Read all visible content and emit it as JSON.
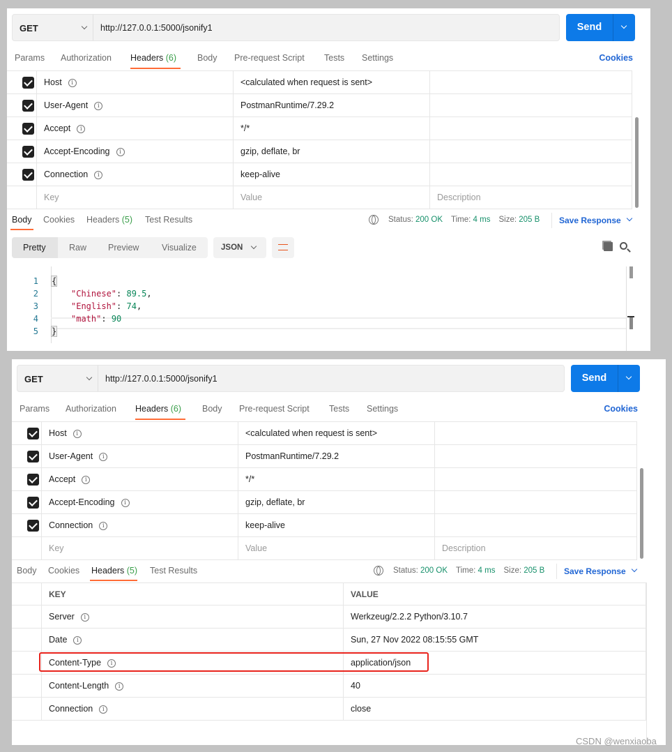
{
  "panels": [
    {
      "method": "GET",
      "url": "http://127.0.0.1:5000/jsonify1",
      "send_label": "Send",
      "request_tabs": [
        {
          "label": "Params"
        },
        {
          "label": "Authorization"
        },
        {
          "label": "Headers",
          "count": "(6)",
          "active": true
        },
        {
          "label": "Body"
        },
        {
          "label": "Pre-request Script"
        },
        {
          "label": "Tests"
        },
        {
          "label": "Settings"
        }
      ],
      "cookies_link": "Cookies",
      "request_headers": [
        {
          "key": "Host",
          "value": "<calculated when request is sent>",
          "checked": true
        },
        {
          "key": "User-Agent",
          "value": "PostmanRuntime/7.29.2",
          "checked": true
        },
        {
          "key": "Accept",
          "value": "*/*",
          "checked": true
        },
        {
          "key": "Accept-Encoding",
          "value": "gzip, deflate, br",
          "checked": true
        },
        {
          "key": "Connection",
          "value": "keep-alive",
          "checked": true
        }
      ],
      "placeholders": {
        "key": "Key",
        "value": "Value",
        "description": "Description"
      },
      "response_tabs": [
        {
          "label": "Body",
          "active": true
        },
        {
          "label": "Cookies"
        },
        {
          "label": "Headers",
          "count": "(5)"
        },
        {
          "label": "Test Results"
        }
      ],
      "status": {
        "status_label": "Status:",
        "status": "200 OK",
        "time_label": "Time:",
        "time": "4 ms",
        "size_label": "Size:",
        "size": "205 B"
      },
      "save_response": "Save Response",
      "format_tabs": [
        "Pretty",
        "Raw",
        "Preview",
        "Visualize"
      ],
      "format_active": "Pretty",
      "language": "JSON",
      "code_lines": [
        {
          "n": "1",
          "text": "{"
        },
        {
          "n": "2",
          "key": "\"Chinese\"",
          "value": "89.5",
          "trail": ","
        },
        {
          "n": "3",
          "key": "\"English\"",
          "value": "74",
          "trail": ","
        },
        {
          "n": "4",
          "key": "\"math\"",
          "value": "90",
          "trail": ""
        },
        {
          "n": "5",
          "text": "}"
        }
      ]
    },
    {
      "method": "GET",
      "url": "http://127.0.0.1:5000/jsonify1",
      "send_label": "Send",
      "request_tabs": [
        {
          "label": "Params"
        },
        {
          "label": "Authorization"
        },
        {
          "label": "Headers",
          "count": "(6)",
          "active": true
        },
        {
          "label": "Body"
        },
        {
          "label": "Pre-request Script"
        },
        {
          "label": "Tests"
        },
        {
          "label": "Settings"
        }
      ],
      "cookies_link": "Cookies",
      "request_headers": [
        {
          "key": "Host",
          "value": "<calculated when request is sent>",
          "checked": true
        },
        {
          "key": "User-Agent",
          "value": "PostmanRuntime/7.29.2",
          "checked": true
        },
        {
          "key": "Accept",
          "value": "*/*",
          "checked": true
        },
        {
          "key": "Accept-Encoding",
          "value": "gzip, deflate, br",
          "checked": true
        },
        {
          "key": "Connection",
          "value": "keep-alive",
          "checked": true
        }
      ],
      "placeholders": {
        "key": "Key",
        "value": "Value",
        "description": "Description"
      },
      "response_tabs": [
        {
          "label": "Body"
        },
        {
          "label": "Cookies"
        },
        {
          "label": "Headers",
          "count": "(5)",
          "active": true
        },
        {
          "label": "Test Results"
        }
      ],
      "status": {
        "status_label": "Status:",
        "status": "200 OK",
        "time_label": "Time:",
        "time": "4 ms",
        "size_label": "Size:",
        "size": "205 B"
      },
      "save_response": "Save Response",
      "response_headers": {
        "columns": [
          "KEY",
          "VALUE"
        ],
        "rows": [
          {
            "key": "Server",
            "value": "Werkzeug/2.2.2 Python/3.10.7"
          },
          {
            "key": "Date",
            "value": "Sun, 27 Nov 2022 08:15:55 GMT"
          },
          {
            "key": "Content-Type",
            "value": "application/json",
            "highlighted": true
          },
          {
            "key": "Content-Length",
            "value": "40"
          },
          {
            "key": "Connection",
            "value": "close"
          }
        ]
      }
    }
  ],
  "colors": {
    "accent": "#ff6c37",
    "send": "#0d7ae8",
    "link": "#2166d4",
    "highlight_box": "#e8231c",
    "status_ok": "#16906a"
  },
  "watermark": "CSDN @wenxiaoba"
}
